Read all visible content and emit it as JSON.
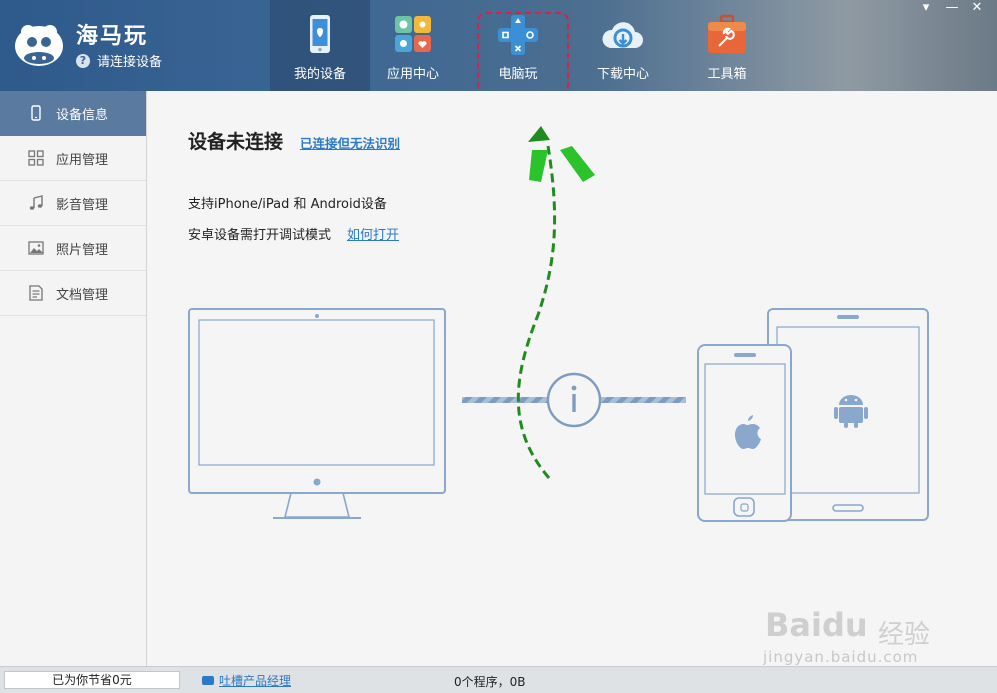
{
  "app": {
    "title": "海马玩",
    "status": "请连接设备"
  },
  "window_controls": {
    "menu": "▾",
    "minimize": "—",
    "close": "✕"
  },
  "nav": {
    "tabs": [
      {
        "label": "我的设备",
        "icon": "phone-device-icon",
        "active": true
      },
      {
        "label": "应用中心",
        "icon": "app-center-icon",
        "active": false
      },
      {
        "label": "电脑玩",
        "icon": "gamepad-icon",
        "active": false
      },
      {
        "label": "下载中心",
        "icon": "cloud-download-icon",
        "active": false
      },
      {
        "label": "工具箱",
        "icon": "toolbox-icon",
        "active": false
      }
    ]
  },
  "sidebar": {
    "items": [
      {
        "label": "设备信息",
        "icon": "phone-icon",
        "active": true
      },
      {
        "label": "应用管理",
        "icon": "grid-icon",
        "active": false
      },
      {
        "label": "影音管理",
        "icon": "music-note-icon",
        "active": false
      },
      {
        "label": "照片管理",
        "icon": "image-icon",
        "active": false
      },
      {
        "label": "文档管理",
        "icon": "document-icon",
        "active": false
      }
    ]
  },
  "main": {
    "title": "设备未连接",
    "title_link": "已连接但无法识别",
    "line1": "支持iPhone/iPad 和 Android设备",
    "line2": "安卓设备需打开调试模式",
    "line2_link": "如何打开"
  },
  "statusbar": {
    "saved": "已为你节省0元",
    "feedback": "吐槽产品经理",
    "programs": "0个程序，0B"
  },
  "watermark": {
    "brand": "Bai",
    "brand2": "du",
    "cn": "经验",
    "url": "jingyan.baidu.com"
  },
  "colors": {
    "accent": "#2a7ac7",
    "sidebar_active": "#5b7a9f",
    "highlight": "#d8204c",
    "arrow": "#2bc22b"
  }
}
